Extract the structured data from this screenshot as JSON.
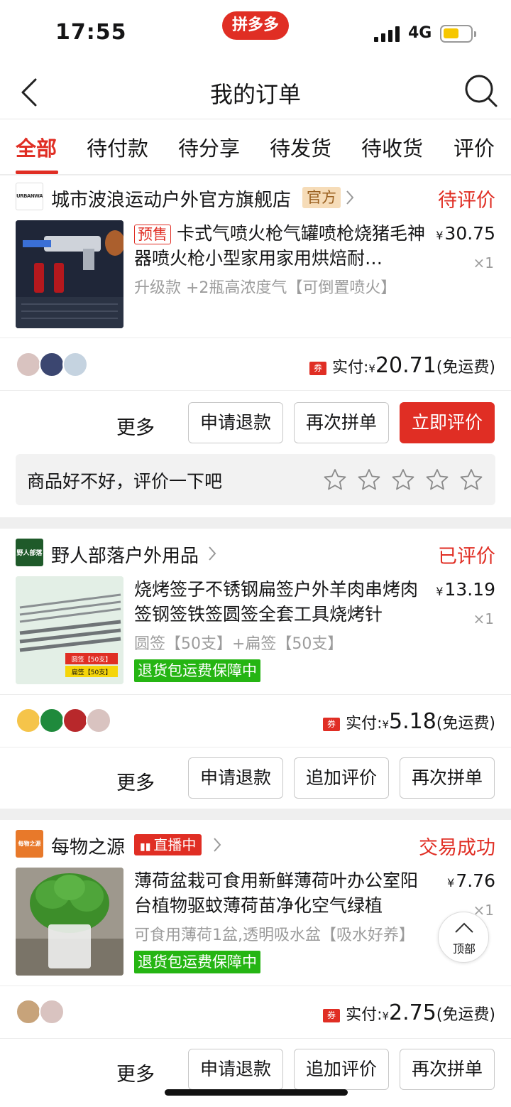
{
  "status_bar": {
    "time": "17:55",
    "brand": "拼多多",
    "network": "4G"
  },
  "nav": {
    "title": "我的订单"
  },
  "tabs": [
    {
      "label": "全部",
      "active": true
    },
    {
      "label": "待付款"
    },
    {
      "label": "待分享"
    },
    {
      "label": "待发货"
    },
    {
      "label": "待收货"
    },
    {
      "label": "评价"
    }
  ],
  "orders": [
    {
      "shop_name": "城市波浪运动户外官方旗舰店",
      "shop_logo_text": "URBANWAVE",
      "shop_tag": "官方",
      "status": "待评价",
      "presale_tag": "预售",
      "title": "卡式气喷火枪气罐喷枪烧猪毛神器喷火枪小型家用家用烘焙耐…",
      "spec": "升级款 +2瓶高浓度气【可倒置喷火】",
      "price": "30.75",
      "currency": "¥",
      "qty": "×1",
      "coupon_tag": "券",
      "paid_label": "实付:",
      "paid_amount": "20.71",
      "shipping": "(免运费)",
      "actions": {
        "more": "更多",
        "refund": "申请退款",
        "rebuy": "再次拼单",
        "review": "立即评价"
      },
      "rate_prompt": "商品好不好，评价一下吧"
    },
    {
      "shop_name": "野人部落户外用品",
      "shop_logo_text": "野人部落",
      "status": "已评价",
      "title": "烧烤签子不锈钢扁签户外羊肉串烤肉签钢签铁签圆签全套工具烧烤针",
      "spec": "圆签【50支】+扁签【50支】",
      "guarantee": "退货包运费保障中",
      "thumb_labels": [
        "圆签【50支】",
        "扁签【50支】"
      ],
      "price": "13.19",
      "currency": "¥",
      "qty": "×1",
      "coupon_tag": "券",
      "paid_label": "实付:",
      "paid_amount": "5.18",
      "shipping": "(免运费)",
      "actions": {
        "more": "更多",
        "refund": "申请退款",
        "add_review": "追加评价",
        "rebuy": "再次拼单"
      }
    },
    {
      "shop_name": "每物之源",
      "shop_logo_text": "每物之源",
      "live_tag": "直播中",
      "status": "交易成功",
      "title": "薄荷盆栽可食用新鲜薄荷叶办公室阳台植物驱蚊薄荷苗净化空气绿植",
      "spec": "可食用薄荷1盆,透明吸水盆【吸水好养】",
      "guarantee": "退货包运费保障中",
      "price": "7.76",
      "currency": "¥",
      "qty": "×1",
      "coupon_tag": "券",
      "paid_label": "实付:",
      "paid_amount": "2.75",
      "shipping": "(免运费)",
      "actions": {
        "more": "更多",
        "refund": "申请退款",
        "add_review": "追加评价",
        "rebuy": "再次拼单"
      }
    }
  ],
  "float_top_label": "顶部",
  "colors": {
    "accent": "#e02e24",
    "guarantee": "#25b513",
    "official_tag_bg": "#f6dcb8",
    "muted": "#9c9c9c"
  }
}
